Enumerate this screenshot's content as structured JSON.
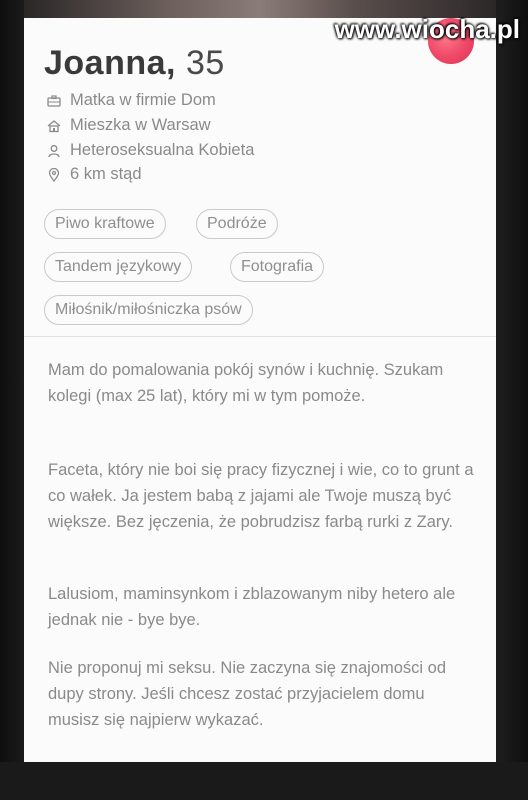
{
  "watermark": "www.wiocha.pl",
  "profile": {
    "name": "Joanna,",
    "age": "35",
    "job": "Matka w firmie Dom",
    "lives": "Mieszka w Warsaw",
    "orientation": "Heteroseksualna Kobieta",
    "distance": "6 km stąd"
  },
  "icons": {
    "job": "briefcase-icon",
    "lives": "home-icon",
    "orientation": "person-icon",
    "distance": "location-pin-icon",
    "like": "like-button-icon"
  },
  "interests": [
    "Piwo kraftowe",
    "Podróże",
    "Tandem językowy",
    "Fotografia",
    "Miłośnik/miłośniczka psów"
  ],
  "bio": [
    "Mam do pomalowania pokój synów i kuchnię. Szukam kolegi (max 25 lat), który mi w tym pomoże.",
    "Faceta, który nie boi się pracy fizycznej i wie, co to grunt a co wałek. Ja jestem babą z jajami ale Twoje muszą być większe. Bez jęczenia, że pobrudzisz farbą rurki z Zary.",
    "Lalusiom, maminsynkom i zblazowanym niby hetero ale jednak nie - bye bye.",
    "Nie proponuj mi seksu. Nie zaczyna się znajomości od dupy strony. Jeśli chcesz zostać przyjacielem domu musisz się najpierw wykazać."
  ],
  "colors": {
    "like": "#f04a6a",
    "text": "#8a8a8a",
    "name": "#3a3a3a"
  }
}
